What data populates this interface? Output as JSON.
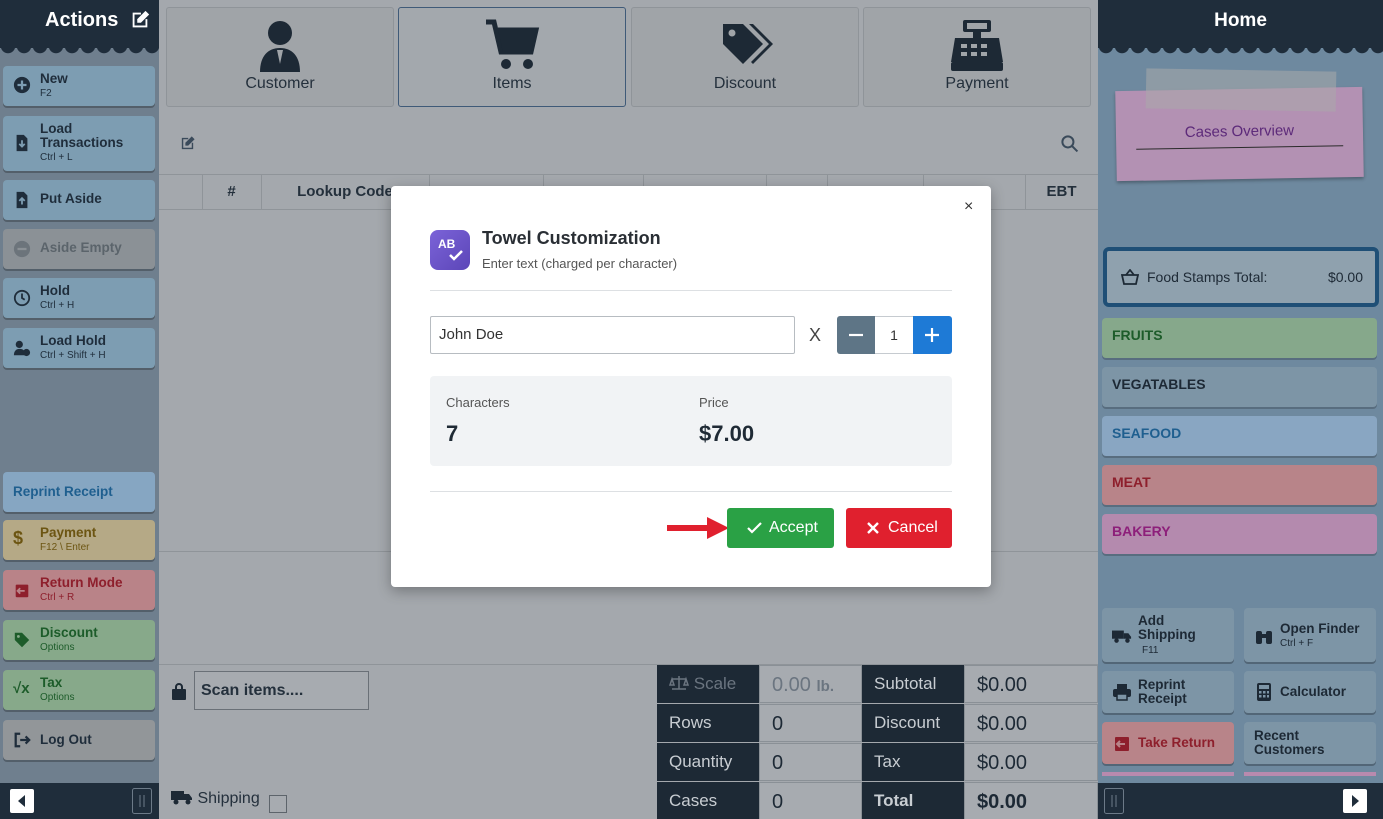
{
  "left_sidebar": {
    "title": "Actions",
    "buttons": [
      {
        "label": "New",
        "sub": "F2"
      },
      {
        "label": "Load",
        "label2": "Transactions",
        "sub": "Ctrl + L"
      },
      {
        "label": "Put Aside",
        "sub": ""
      },
      {
        "label": "Aside Empty",
        "sub": ""
      },
      {
        "label": "Hold",
        "sub": "Ctrl + H"
      },
      {
        "label": "Load Hold",
        "sub": "Ctrl + Shift + H"
      },
      {
        "label": "Reprint Receipt",
        "sub": ""
      },
      {
        "label": "Payment",
        "sub": "F12 \\ Enter"
      },
      {
        "label": "Return Mode",
        "sub": "Ctrl + R"
      },
      {
        "label": "Discount",
        "sub": "Options"
      },
      {
        "label": "Tax",
        "sub": "Options"
      },
      {
        "label": "Log Out",
        "sub": ""
      }
    ]
  },
  "tabs": [
    {
      "label": "Customer",
      "icon": "customer-icon"
    },
    {
      "label": "Items",
      "icon": "cart-icon"
    },
    {
      "label": "Discount",
      "icon": "tags-icon"
    },
    {
      "label": "Payment",
      "icon": "cash-register-icon"
    }
  ],
  "table": {
    "columns": [
      "#",
      "Lookup Code",
      "",
      "",
      "",
      "",
      "",
      "",
      "EBT"
    ]
  },
  "scan": {
    "placeholder": "Scan items...."
  },
  "shipping_label": "Shipping",
  "totals": {
    "scale_label": "Scale",
    "scale_value": "0.00",
    "scale_unit": "lb.",
    "rows_label": "Rows",
    "rows_value": "0",
    "quantity_label": "Quantity",
    "quantity_value": "0",
    "cases_label": "Cases",
    "cases_value": "0",
    "subtotal_label": "Subtotal",
    "subtotal_value": "$0.00",
    "discount_label": "Discount",
    "discount_value": "$0.00",
    "tax_label": "Tax",
    "tax_value": "$0.00",
    "total_label": "Total",
    "total_value": "$0.00"
  },
  "right_sidebar": {
    "title": "Home",
    "note_title": "Cases Overview",
    "food_stamps_label": "Food Stamps Total:",
    "food_stamps_value": "$0.00",
    "categories": [
      {
        "label": "FRUITS",
        "color": "#86a88b"
      },
      {
        "label": "VEGATABLES",
        "color": "#7d95a6"
      },
      {
        "label": "SEAFOOD",
        "color": "#89a6c2"
      },
      {
        "label": "MEAT",
        "color": "#b88489"
      },
      {
        "label": "BAKERY",
        "color": "#b48aae"
      }
    ],
    "buttons": [
      {
        "label": "Add",
        "label2": "Shipping",
        "sub": "F11"
      },
      {
        "label": "Open Finder",
        "sub": "Ctrl + F"
      },
      {
        "label": "Reprint",
        "label2": "Receipt",
        "sub": ""
      },
      {
        "label": "Calculator",
        "sub": ""
      },
      {
        "label": "Take Return",
        "sub": ""
      },
      {
        "label": "Recent",
        "label2": "Customers",
        "sub": ""
      }
    ]
  },
  "modal": {
    "title": "Towel Customization",
    "subtitle": "Enter text (charged per character)",
    "icon_text": "AB",
    "input_value": "John Doe",
    "multiply": "X",
    "quantity": "1",
    "characters_label": "Characters",
    "characters_value": "7",
    "price_label": "Price",
    "price_value": "$7.00",
    "accept_label": "Accept",
    "cancel_label": "Cancel",
    "close": "×"
  },
  "colors": {
    "accept": "#2aa145",
    "cancel": "#e0202e",
    "plus": "#1e7ad6",
    "navy": "#1f2d3b"
  }
}
